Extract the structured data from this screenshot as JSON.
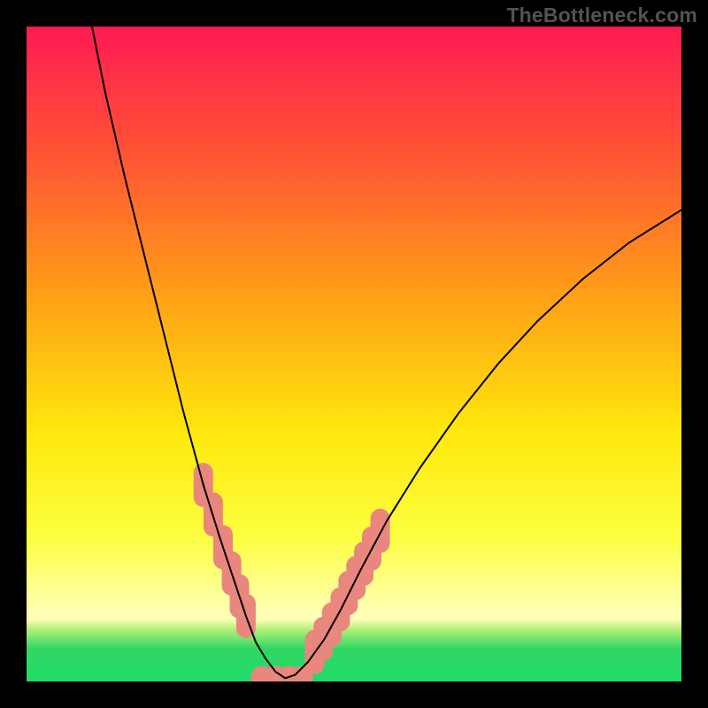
{
  "watermark": "TheBottleneck.com",
  "chart_data": {
    "type": "line",
    "title": "",
    "xlabel": "",
    "ylabel": "",
    "xlim": [
      0,
      100
    ],
    "ylim": [
      0,
      100
    ],
    "grid": false,
    "legend": false,
    "background_gradient_stops": [
      {
        "offset": 0.0,
        "color": "#ff1a52"
      },
      {
        "offset": 0.2,
        "color": "#ff5534"
      },
      {
        "offset": 0.42,
        "color": "#ffa316"
      },
      {
        "offset": 0.62,
        "color": "#ffe80c"
      },
      {
        "offset": 0.78,
        "color": "#fcff3f"
      },
      {
        "offset": 0.87,
        "color": "#ffff9d"
      },
      {
        "offset": 0.905,
        "color": "#ffffba"
      },
      {
        "offset": 0.92,
        "color": "#b4f07a"
      },
      {
        "offset": 0.95,
        "color": "#31d764"
      },
      {
        "offset": 1.0,
        "color": "#21db69"
      }
    ],
    "series": [
      {
        "name": "bottleneck-curve",
        "type": "line",
        "color": "#000000",
        "stroke_width": 2,
        "x": [
          10.0,
          12.0,
          15.0,
          18.0,
          21.0,
          24.0,
          27.0,
          29.5,
          31.5,
          33.5,
          35.0,
          36.5,
          38.0,
          39.5,
          41.0,
          43.0,
          45.5,
          48.0,
          51.0,
          55.0,
          60.0,
          66.0,
          72.0,
          78.0,
          85.0,
          92.0,
          100.0
        ],
        "y": [
          100.0,
          90.0,
          77.0,
          65.0,
          53.0,
          41.0,
          30.0,
          22.0,
          16.0,
          10.0,
          6.0,
          3.5,
          1.5,
          0.5,
          1.0,
          3.0,
          6.5,
          11.0,
          17.0,
          24.5,
          32.5,
          41.0,
          48.5,
          55.0,
          61.5,
          67.0,
          72.0
        ]
      },
      {
        "name": "left-band-markers",
        "type": "scatter",
        "color": "#e9877e",
        "marker_w": 22,
        "marker_h": 50,
        "x": [
          27.0,
          28.5,
          30.0,
          31.3,
          32.5,
          33.5
        ],
        "y": [
          30.0,
          25.5,
          20.5,
          16.5,
          13.0,
          10.0
        ]
      },
      {
        "name": "right-band-markers",
        "type": "scatter",
        "color": "#e9877e",
        "marker_w": 22,
        "marker_h": 50,
        "x": [
          44.0,
          45.3,
          46.6,
          47.9,
          49.1,
          50.3,
          51.5,
          52.7,
          54.0
        ],
        "y": [
          4.5,
          6.5,
          8.7,
          11.0,
          13.5,
          15.8,
          18.0,
          20.3,
          23.0
        ]
      },
      {
        "name": "bottom-markers",
        "type": "scatter",
        "color": "#e9877e",
        "marker_w": 26,
        "marker_h": 26,
        "x": [
          36.0,
          38.0,
          40.0,
          42.0
        ],
        "y": [
          0.6,
          0.6,
          0.6,
          0.6
        ]
      }
    ]
  }
}
